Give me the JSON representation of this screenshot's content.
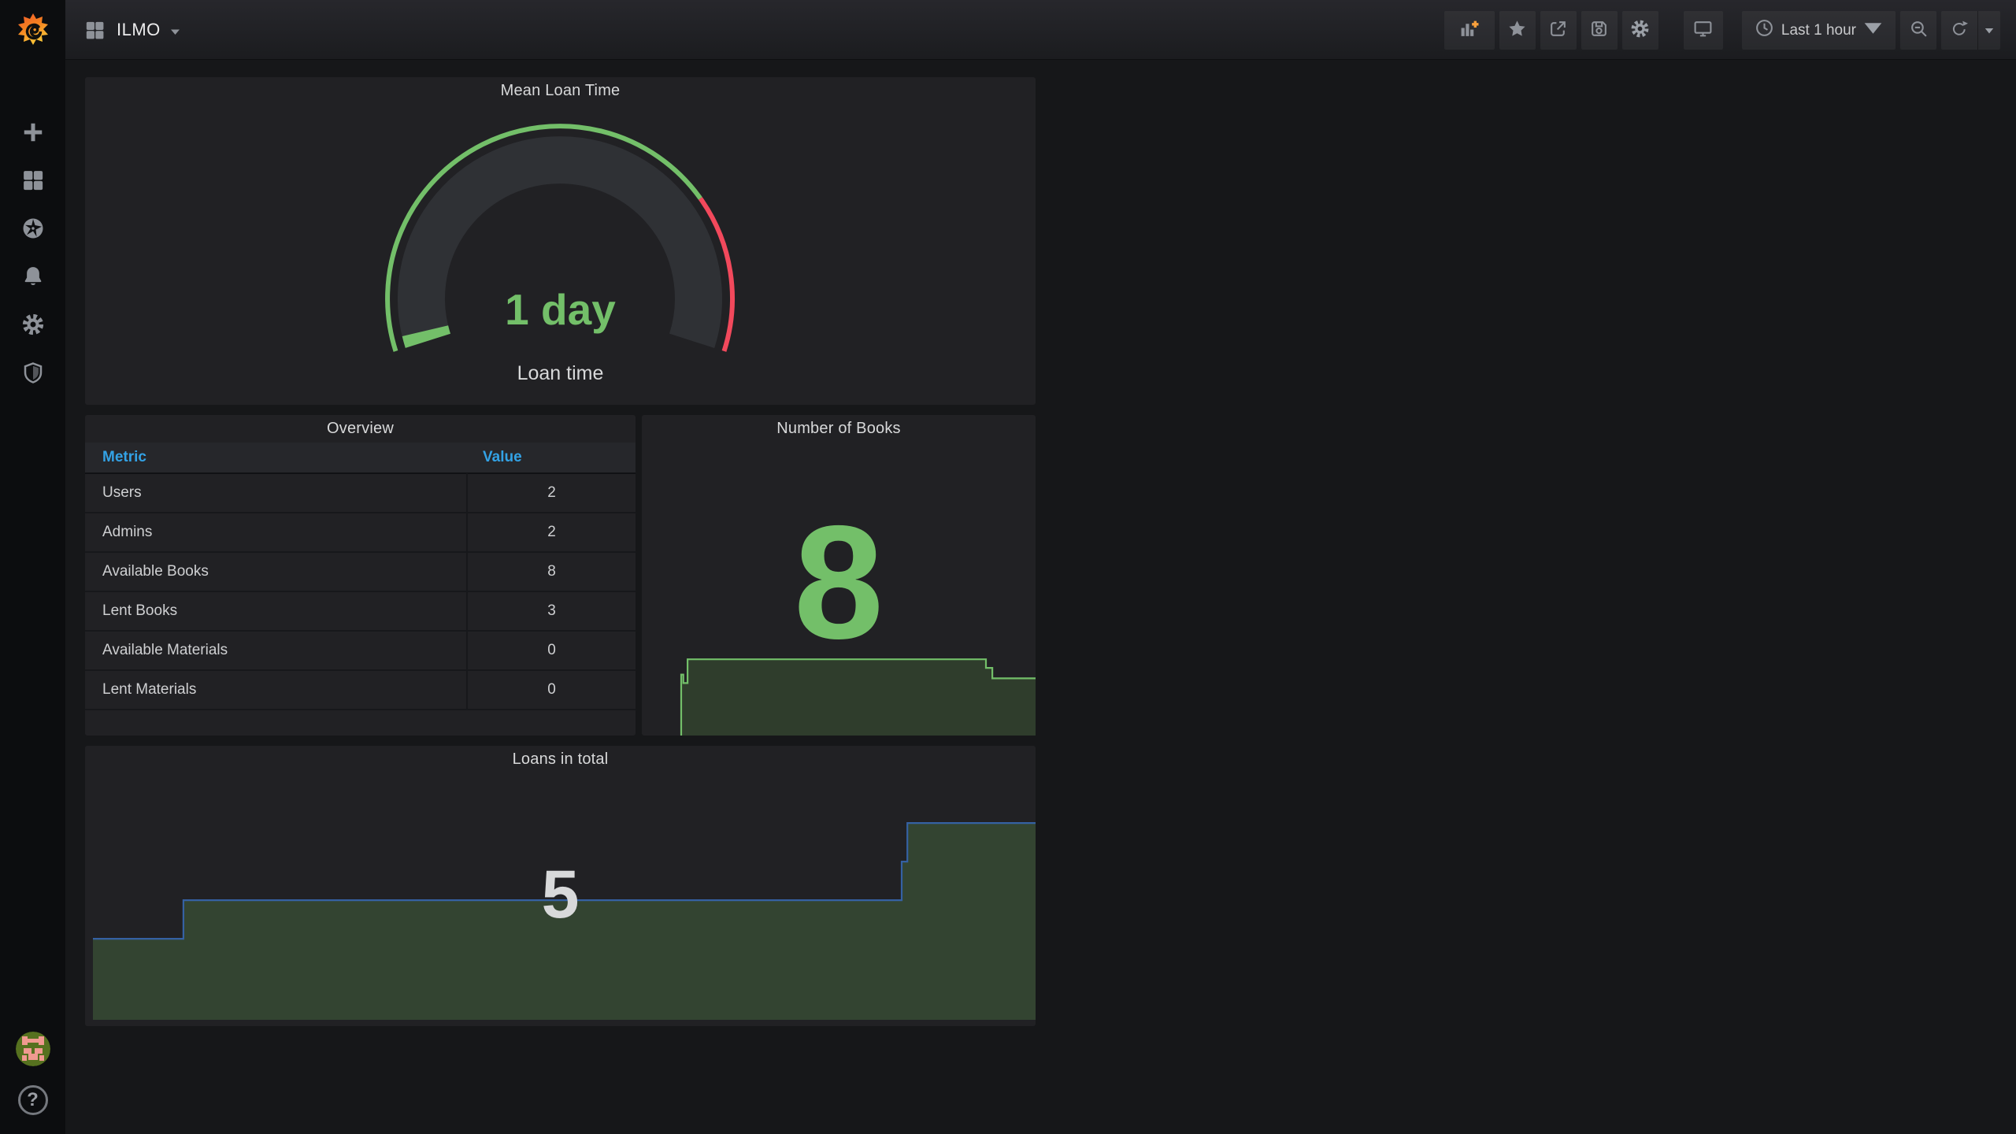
{
  "topbar": {
    "dashboard_title": "ILMO",
    "time_range": "Last 1 hour",
    "action_icons": [
      "add-panel-icon",
      "star-icon",
      "share-icon",
      "save-icon",
      "settings-gear-icon",
      "cycle-view-monitor-icon",
      "clock-icon",
      "zoom-out-icon",
      "refresh-icon",
      "refresh-interval-caret-icon"
    ]
  },
  "sidebar": {
    "icons": [
      "grafana-logo",
      "plus-icon",
      "dashboards-grid-icon",
      "explore-compass-icon",
      "alerting-bell-icon",
      "configuration-gear-icon",
      "server-admin-shield-icon",
      "user-avatar",
      "help-icon"
    ],
    "help_glyph": "?"
  },
  "colors": {
    "green": "#73BF69",
    "red": "#F2495C",
    "blue-line": "#3561a3",
    "loans-fill": "#334431",
    "books-fill": "#2f3d2c",
    "header-blue": "#33a2e5",
    "orange": "#f9a03c",
    "panel-bg": "#212124",
    "page-bg": "#161719",
    "band": "#2f3135"
  },
  "panels": {
    "gauge": {
      "title": "Mean Loan Time",
      "value_text": "1 day",
      "value_label": "Loan time"
    },
    "overview": {
      "title": "Overview",
      "columns": [
        "Metric",
        "Value"
      ],
      "rows": [
        {
          "metric": "Users",
          "value": "2"
        },
        {
          "metric": "Admins",
          "value": "2"
        },
        {
          "metric": "Available Books",
          "value": "8"
        },
        {
          "metric": "Lent Books",
          "value": "3"
        },
        {
          "metric": "Available Materials",
          "value": "0"
        },
        {
          "metric": "Lent Materials",
          "value": "0"
        }
      ]
    },
    "books": {
      "title": "Number of Books",
      "value_text": "8"
    },
    "loans": {
      "title": "Loans in total",
      "value_text": "5"
    }
  },
  "chart_data": [
    {
      "panel": "gauge",
      "type": "gauge",
      "title": "Mean Loan Time",
      "value_text": "1 day",
      "label": "Loan time",
      "start_deg": 197.8,
      "end_deg": -17.8,
      "threshold_green_fraction": 0.753,
      "value_fraction": 0.02,
      "colors": {
        "green": "#73BF69",
        "red": "#F2495C",
        "band": "#2f3135"
      }
    },
    {
      "panel": "books",
      "type": "area",
      "title": "Number of Books",
      "displayed_value": 8,
      "ymin": 0,
      "points": [
        [
          0,
          0
        ],
        [
          0,
          6.4
        ],
        [
          0.006,
          6.4
        ],
        [
          0.006,
          5.5
        ],
        [
          0.018,
          5.5
        ],
        [
          0.018,
          8
        ],
        [
          0.86,
          8
        ],
        [
          0.86,
          7.1
        ],
        [
          0.878,
          7.1
        ],
        [
          0.878,
          6
        ],
        [
          1,
          6
        ]
      ],
      "line_color": "#73BF69",
      "fill_color": "#2f3d2c"
    },
    {
      "panel": "loans",
      "type": "area",
      "title": "Loans in total",
      "displayed_value": 5,
      "ymin": 0.9,
      "points": [
        [
          0,
          3
        ],
        [
          0.096,
          3
        ],
        [
          0.096,
          4
        ],
        [
          0.858,
          4
        ],
        [
          0.858,
          5
        ],
        [
          0.864,
          5
        ],
        [
          0.864,
          6
        ],
        [
          1,
          6
        ]
      ],
      "line_color": "#3561a3",
      "fill_color": "#334431"
    }
  ]
}
